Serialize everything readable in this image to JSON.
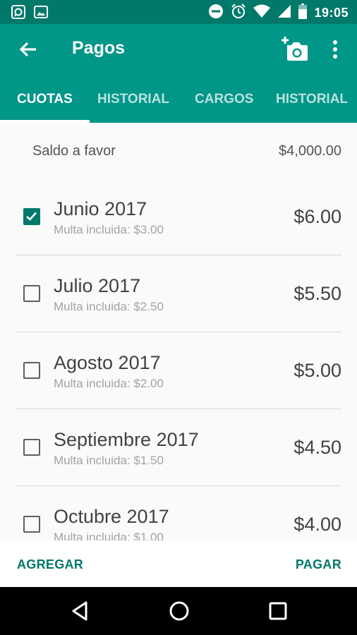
{
  "status_bar": {
    "time": "19:05",
    "icons": [
      "whatsapp-icon",
      "image-icon",
      "do-not-disturb-icon",
      "alarm-icon",
      "wifi-icon",
      "signal-icon",
      "battery-icon"
    ]
  },
  "app_bar": {
    "title": "Pagos",
    "icons": [
      "back-arrow-icon",
      "add-photo-icon",
      "more-vert-icon"
    ]
  },
  "tabs": [
    {
      "label": "CUOTAS",
      "active": true
    },
    {
      "label": "HISTORIAL",
      "active": false
    },
    {
      "label": "CARGOS",
      "active": false
    },
    {
      "label": "HISTORIAL",
      "active": false
    }
  ],
  "balance": {
    "label": "Saldo a favor",
    "value": "$4,000.00"
  },
  "dues": [
    {
      "month": "Junio 2017",
      "fine": "Multa incluida: $3.00",
      "amount": "$6.00",
      "checked": true
    },
    {
      "month": "Julio 2017",
      "fine": "Multa incluida: $2.50",
      "amount": "$5.50",
      "checked": false
    },
    {
      "month": "Agosto 2017",
      "fine": "Multa incluida: $2.00",
      "amount": "$5.00",
      "checked": false
    },
    {
      "month": "Septiembre 2017",
      "fine": "Multa incluida: $1.50",
      "amount": "$4.50",
      "checked": false
    },
    {
      "month": "Octubre 2017",
      "fine": "Multa incluida: $1.00",
      "amount": "$4.00",
      "checked": false
    }
  ],
  "bottom_actions": {
    "add_label": "AGREGAR",
    "pay_label": "PAGAR"
  },
  "nav_bar": {
    "icons": [
      "back-triangle-icon",
      "home-circle-icon",
      "recents-square-icon"
    ]
  },
  "colors": {
    "primary": "#009688",
    "primary_dark": "#00796b",
    "accent": "#00796b"
  }
}
